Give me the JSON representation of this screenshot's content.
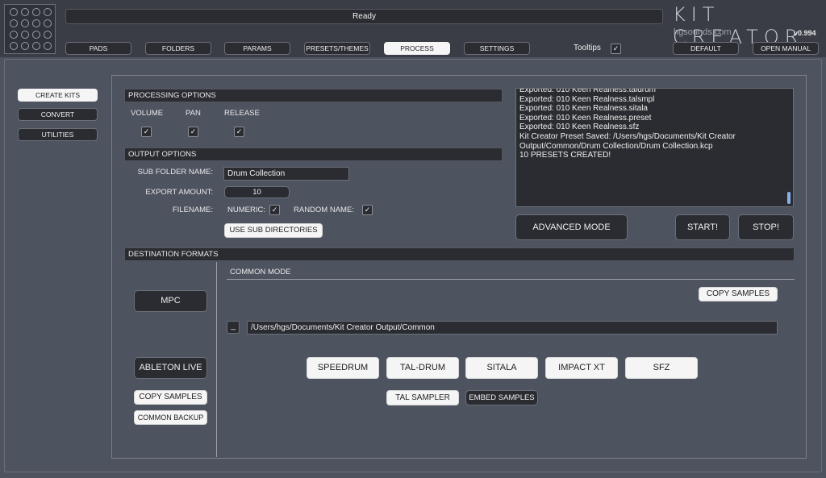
{
  "status": {
    "text": "Ready"
  },
  "brand": {
    "title": "KIT CREATOR",
    "subtitle": "hgsounds.com",
    "version": "v0.994"
  },
  "nav": {
    "pads": "PADS",
    "folders": "FOLDERS",
    "params": "PARAMS",
    "presets": "PRESETS/THEMES",
    "process": "PROCESS",
    "settings": "SETTINGS"
  },
  "tooltips": {
    "label": "Tooltips",
    "checked": "✓"
  },
  "topright": {
    "default": "DEFAULT",
    "manual": "OPEN MANUAL"
  },
  "sidebar": {
    "create": "CREATE KITS",
    "convert": "CONVERT",
    "utilities": "UTILITIES"
  },
  "processing": {
    "heading": "PROCESSING OPTIONS",
    "volume": "VOLUME",
    "pan": "PAN",
    "release": "RELEASE",
    "check": "✓"
  },
  "output": {
    "heading": "OUTPUT OPTIONS",
    "subfolder_label": "SUB FOLDER NAME:",
    "subfolder_value": "Drum Collection",
    "export_label": "EXPORT AMOUNT:",
    "export_value": "10",
    "filename_label": "FILENAME:",
    "numeric_label": "NUMERIC:",
    "random_label": "RANDOM NAME:",
    "subdirs_button": "USE SUB DIRECTORIES"
  },
  "log": {
    "lines": [
      "Exported: 010 Keen Realness.taldrum",
      "Exported: 010 Keen Realness.talsmpl",
      "Exported: 010 Keen Realness.sitala",
      "Exported: 010 Keen Realness.preset",
      "Exported: 010 Keen Realness.sfz",
      "",
      "Kit Creator Preset Saved: /Users/hgs/Documents/Kit Creator",
      "Output/Common/Drum Collection/Drum Collection.kcp",
      "",
      "10 PRESETS CREATED!"
    ]
  },
  "actions": {
    "advanced": "ADVANCED MODE",
    "start": "START!",
    "stop": "STOP!"
  },
  "destination": {
    "heading": "DESTINATION FORMATS",
    "mpc": "MPC",
    "ableton": "ABLETON LIVE",
    "copy_samples_left": "COPY SAMPLES",
    "common_backup": "COMMON BACKUP",
    "common_mode": "COMMON MODE",
    "copy_samples_right": "COPY SAMPLES",
    "browse": "_",
    "path": "/Users/hgs/Documents/Kit Creator Output/Common",
    "formats": [
      "SPEEDRUM",
      "TAL-DRUM",
      "SITALA",
      "IMPACT XT",
      "SFZ"
    ],
    "tal_sampler": "TAL SAMPLER",
    "embed_samples": "EMBED SAMPLES"
  }
}
